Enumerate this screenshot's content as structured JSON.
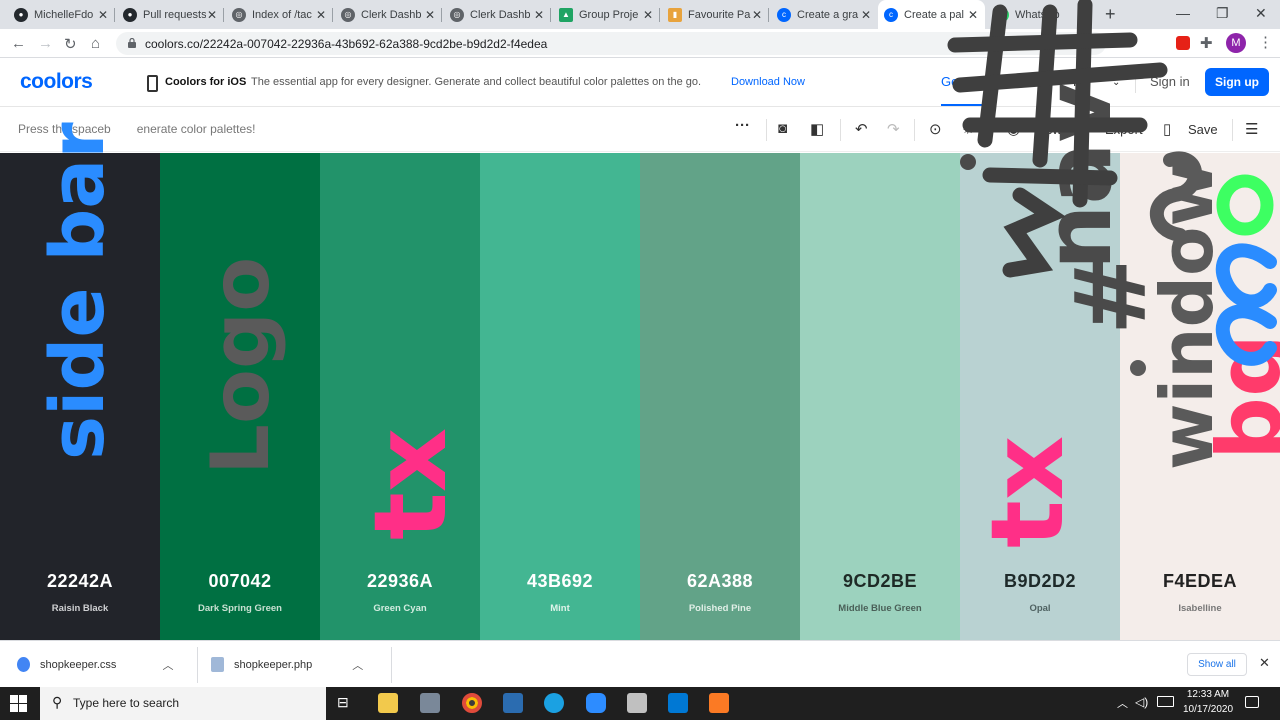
{
  "browser": {
    "tabs": [
      {
        "title": "MichelleFdo",
        "icon": "github-icon",
        "color": "#24292e"
      },
      {
        "title": "Pull requests",
        "icon": "github-icon",
        "color": "#24292e"
      },
      {
        "title": "Index of /tac",
        "icon": "globe-icon",
        "color": "#5f6368"
      },
      {
        "title": "Clerk Dashb",
        "icon": "globe-icon",
        "color": "#5f6368"
      },
      {
        "title": "Clerk Dashb",
        "icon": "globe-icon",
        "color": "#5f6368"
      },
      {
        "title": "Group Proje",
        "icon": "google-drive-icon",
        "color": "#1fa463"
      },
      {
        "title": "Favourite Pa",
        "icon": "favourite-palettes-icon",
        "color": "#e8a33d"
      },
      {
        "title": "Create a gra",
        "icon": "coolors-icon",
        "color": "#0066ff"
      },
      {
        "title": "Create a pal",
        "icon": "coolors-icon",
        "color": "#0066ff",
        "active": true
      },
      {
        "title": "WhatsAp",
        "icon": "whatsapp-icon",
        "color": "#25d366"
      }
    ],
    "url": "coolors.co/22242a-007042-22936a-43b692-62a388-9cd2be-b9d2d2-f4edea",
    "profile_initial": "M"
  },
  "coolors": {
    "logo": "coolors",
    "promo_title": "Coolors for iOS",
    "promo_text": "The essential app for every designer. Generate and collect beautiful color palettes on the go.",
    "promo_link": "Download Now",
    "nav": {
      "generate": "Generat",
      "explore": "Ex",
      "more": "Mo"
    },
    "sign_in": "Sign in",
    "sign_up": "Sign up",
    "hint": "Press the spaceb",
    "hint_rest": "enerate color palettes!",
    "toolbar": {
      "view": "View",
      "export": "Export",
      "save": "Save"
    },
    "palette": [
      {
        "hex": "22242A",
        "name": "Raisin Black",
        "color": "#22242a",
        "text": "#ffffff",
        "sub": "#cfd0d2"
      },
      {
        "hex": "007042",
        "name": "Dark Spring Green",
        "color": "#007042",
        "text": "#ffffff",
        "sub": "#c8e0d2"
      },
      {
        "hex": "22936A",
        "name": "Green Cyan",
        "color": "#22936a",
        "text": "#ffffff",
        "sub": "#d2ece0"
      },
      {
        "hex": "43B692",
        "name": "Mint",
        "color": "#43b692",
        "text": "#ffffff",
        "sub": "#dff3ea"
      },
      {
        "hex": "62A388",
        "name": "Polished Pine",
        "color": "#62a388",
        "text": "#ffffff",
        "sub": "#e1efe7"
      },
      {
        "hex": "9CD2BE",
        "name": "Middle Blue Green",
        "color": "#9cd2be",
        "text": "#1e2a26",
        "sub": "#4a6058"
      },
      {
        "hex": "B9D2D2",
        "name": "Opal",
        "color": "#b9d2d2",
        "text": "#1e2a2a",
        "sub": "#4f6262"
      },
      {
        "hex": "F4EDEA",
        "name": "Isabelline",
        "color": "#f4edea",
        "text": "#222222",
        "sub": "#777777"
      }
    ]
  },
  "downloads": {
    "items": [
      {
        "name": "shopkeeper.css",
        "icon": "chrome-file-icon"
      },
      {
        "name": "shopkeeper.php",
        "icon": "php-file-icon"
      }
    ],
    "show_all": "Show all"
  },
  "taskbar": {
    "search_placeholder": "Type here to search",
    "time": "12:33 AM",
    "date": "10/17/2020"
  },
  "annotations": {
    "sidebar": "side bar",
    "logo": "Logo",
    "text1": "tx",
    "text2": "tx",
    "navbar": "nav",
    "window": "window",
    "bg": "bg",
    "hash": "#"
  }
}
